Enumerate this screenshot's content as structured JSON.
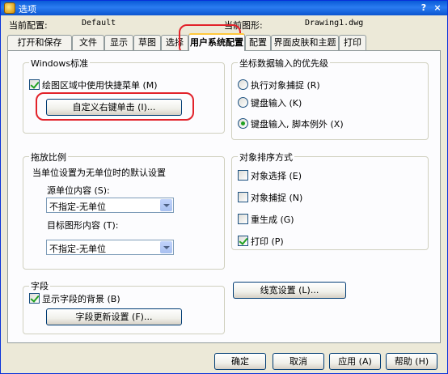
{
  "window": {
    "title": "选项",
    "help": "?",
    "close": "×"
  },
  "header": {
    "profile_label": "当前配置:",
    "profile_value": "Default",
    "drawing_label": "当前图形:",
    "drawing_value": "Drawing1.dwg"
  },
  "tabs": [
    {
      "label": "打开和保存"
    },
    {
      "label": "文件"
    },
    {
      "label": "显示"
    },
    {
      "label": "草图"
    },
    {
      "label": "选择"
    },
    {
      "label": "用户系统配置",
      "active": true
    },
    {
      "label": "配置"
    },
    {
      "label": "界面皮肤和主题"
    },
    {
      "label": "打印"
    }
  ],
  "windows_std": {
    "title": "Windows标准",
    "shortcut_menu": {
      "label": "绘图区域中使用快捷菜单 (M)",
      "checked": true
    },
    "right_click_button": "自定义右键单击 (I)..."
  },
  "coord": {
    "title": "坐标数据输入的优先级",
    "options": [
      {
        "label": "执行对象捕捉 (R)",
        "checked": false
      },
      {
        "label": "键盘输入 (K)",
        "checked": false
      },
      {
        "label": "键盘输入, 脚本例外 (X)",
        "checked": true
      }
    ]
  },
  "drag_scale": {
    "title": "拖放比例",
    "description": "当单位设置为无单位时的默认设置",
    "source_label": "源单位内容 (S):",
    "source_value": "不指定-无单位",
    "target_label": "目标图形内容 (T):",
    "target_value": "不指定-无单位"
  },
  "sort": {
    "title": "对象排序方式",
    "items": [
      {
        "label": "对象选择 (E)",
        "checked": false
      },
      {
        "label": "对象捕捉 (N)",
        "checked": false
      },
      {
        "label": "重生成 (G)",
        "checked": false
      },
      {
        "label": "打印 (P)",
        "checked": true
      }
    ]
  },
  "fields": {
    "title": "字段",
    "show_background": {
      "label": "显示字段的背景 (B)",
      "checked": true
    },
    "update_button": "字段更新设置 (F)..."
  },
  "lineweight_button": "线宽设置 (L)...",
  "footer": {
    "ok": "确定",
    "cancel": "取消",
    "apply": "应用 (A)",
    "help": "帮助 (H)"
  },
  "colors": {
    "highlight": "#e2222a",
    "titlebar": "#0a5bd8",
    "tab_accent": "#ffc83c"
  }
}
